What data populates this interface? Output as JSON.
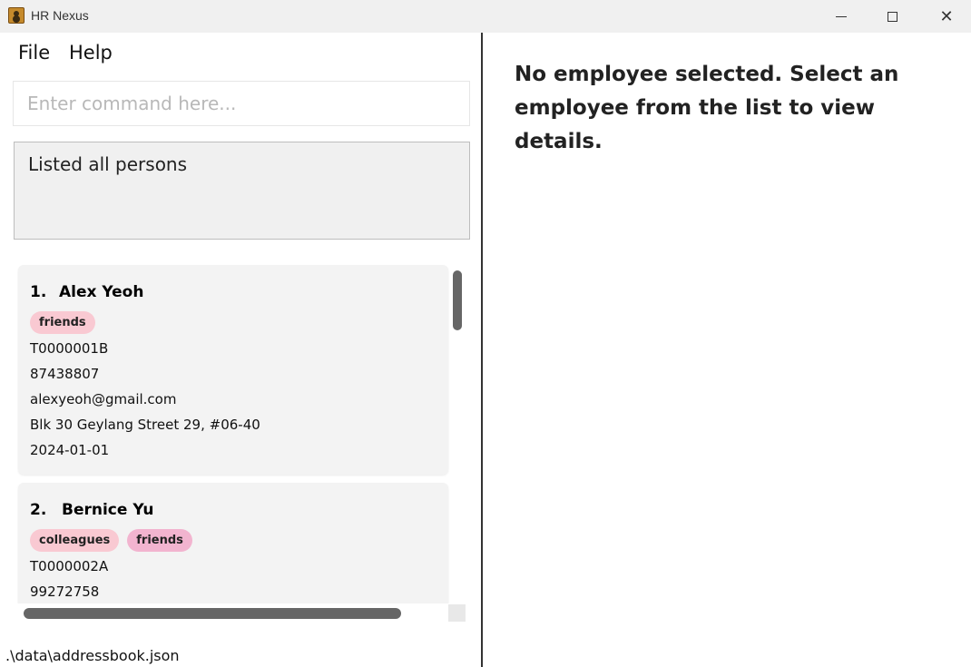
{
  "window": {
    "title": "HR Nexus",
    "minimize_symbol": "—",
    "maximize_symbol": "□",
    "close_symbol": "✕"
  },
  "menu": {
    "items": [
      {
        "label": "File"
      },
      {
        "label": "Help"
      }
    ]
  },
  "command": {
    "placeholder": "Enter command here...",
    "value": ""
  },
  "result": {
    "text": "Listed all persons"
  },
  "persons": [
    {
      "index": "1.",
      "name": "Alex Yeoh",
      "tags": [
        "friends"
      ],
      "nric": "T0000001B",
      "phone": "87438807",
      "email": "alexyeoh@gmail.com",
      "address": "Blk 30 Geylang Street 29, #06-40",
      "date": "2024-01-01"
    },
    {
      "index": "2.",
      "name": "Bernice Yu",
      "tags": [
        "colleagues",
        "friends"
      ],
      "nric": "T0000002A",
      "phone": "99272758"
    }
  ],
  "status": {
    "file_path": ".\\data\\addressbook.json"
  },
  "detail": {
    "empty_message": "No employee selected. Select an employee from the list to view details."
  },
  "colors": {
    "tag_friends": "#f9c9d2",
    "tag_friends_alt": "#f2b4cf",
    "card_bg": "#f3f3f3",
    "result_bg": "#f0f0f0",
    "scrollbar": "#666666"
  },
  "icons": {
    "app": "hr-nexus-app-icon",
    "minimize": "minimize-icon",
    "maximize": "maximize-icon",
    "close": "close-icon"
  }
}
